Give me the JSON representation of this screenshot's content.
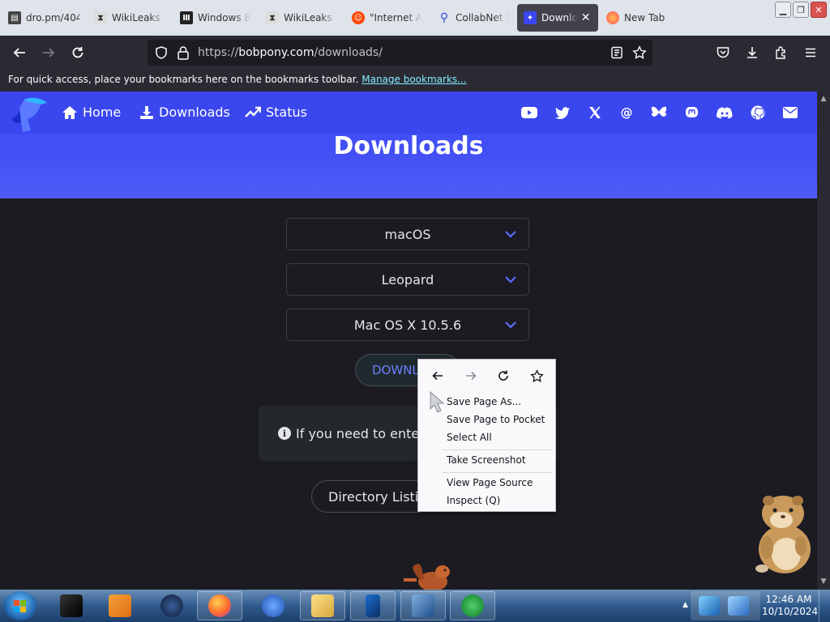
{
  "browser": {
    "tabs": [
      {
        "label": "dro.pm/404",
        "favicon": "terminal-icon",
        "color": "#555555"
      },
      {
        "label": "WikiLeaks -",
        "favicon": "wikileaks-icon",
        "color": "#d0d0d0"
      },
      {
        "label": "Windows 8",
        "favicon": "archive-icon",
        "color": "#333333"
      },
      {
        "label": "WikiLeaks -",
        "favicon": "wikileaks-icon",
        "color": "#d0d0d0"
      },
      {
        "label": "\"Internet A",
        "favicon": "reddit-icon",
        "color": "#ff4500"
      },
      {
        "label": "CollabNet S",
        "favicon": "search-icon",
        "color": "#2b4cd8"
      },
      {
        "label": "Downlo",
        "favicon": "bobpony-icon",
        "color": "#3a46ee",
        "active": true
      },
      {
        "label": "New Tab",
        "favicon": "firefox-icon",
        "color": "#ff7139"
      }
    ],
    "url_scheme": "https://",
    "url_host": "bobpony.com",
    "url_path": "/downloads/",
    "bookmarks_message": "For quick access, place your bookmarks here on the bookmarks toolbar.",
    "bookmarks_link": "Manage bookmarks..."
  },
  "site": {
    "nav": [
      {
        "label": "Home",
        "icon": "home-icon"
      },
      {
        "label": "Downloads",
        "icon": "download-icon"
      },
      {
        "label": "Status",
        "icon": "trending-up-icon"
      }
    ],
    "social_icons": [
      "youtube-icon",
      "twitter-icon",
      "x-icon",
      "threads-icon",
      "bluesky-icon",
      "mastodon-icon",
      "discord-icon",
      "github-icon",
      "email-icon"
    ],
    "title": "Downloads",
    "selects": [
      {
        "value": "macOS"
      },
      {
        "value": "Leopard"
      },
      {
        "value": "Mac OS X 10.5.6"
      }
    ],
    "download_button": "DOWNLOAD",
    "info_text": "If you need to enter a",
    "directory_button": "Directory Listing"
  },
  "context_menu": {
    "items": [
      {
        "label": "Save Page As..."
      },
      {
        "label": "Save Page to Pocket"
      },
      {
        "label": "Select All"
      },
      {
        "label": "Take Screenshot"
      },
      {
        "label": "View Page Source"
      },
      {
        "label": "Inspect (Q)"
      }
    ]
  },
  "taskbar": {
    "time": "12:46 AM",
    "date": "10/10/2024"
  },
  "colors": {
    "accent": "#3a46ee",
    "page_bg": "#1c1b22"
  }
}
